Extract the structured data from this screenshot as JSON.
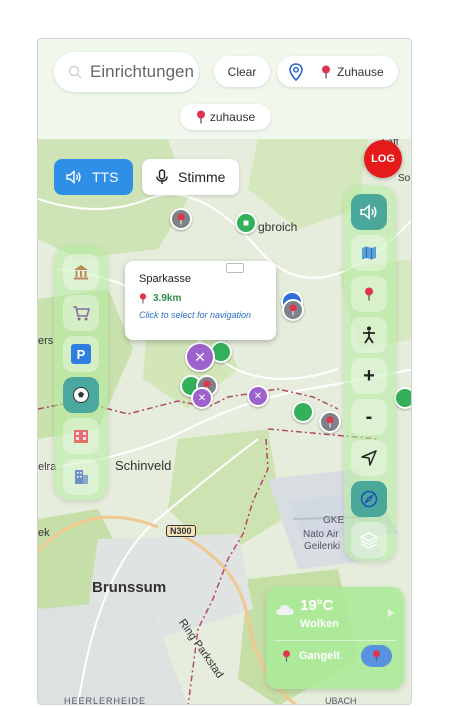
{
  "search": {
    "placeholder": "Einrichtungen"
  },
  "toolbar": {
    "clear_label": "Clear",
    "home_label": "Zuhause"
  },
  "chip": {
    "label": "zuhause"
  },
  "log_button": {
    "label": "LOG"
  },
  "voice": {
    "tts_label": "TTS",
    "voice_label": "Stimme"
  },
  "popup": {
    "title": "Sparkasse",
    "distance": "3.9km",
    "hint": "Click to select for navigation"
  },
  "map_labels": {
    "schinveld": "Schinveld",
    "brunssum": "Brunssum",
    "n300": "N300",
    "ringparkstad": "Ring Parkstad",
    "gke": "GKE",
    "nato1": "Nato Air",
    "nato2": "Geilenki",
    "heerlerheide": "HEERLERHEIDE",
    "gbroich": "gbroich",
    "laff": "Laff",
    "so": "So",
    "ers": "ers",
    "elra": "elra",
    "ek": "ek",
    "ubach": "UBACH"
  },
  "left_panel": {
    "items": [
      "bank-icon",
      "cart-icon",
      "parking-icon",
      "soccer-icon",
      "hotel-icon",
      "office-icon"
    ],
    "active_index": 3
  },
  "right_panel": {
    "zoom_in_label": "+",
    "zoom_out_label": "-"
  },
  "weather": {
    "temperature": "19°C",
    "condition": "Wolken",
    "location": "Gangelt"
  },
  "colors": {
    "accent": "#2f8fe6",
    "panel": "#b4eba0",
    "log": "#e51a1a",
    "marker_green": "#35b05a",
    "marker_purple": "#9d62cc"
  }
}
